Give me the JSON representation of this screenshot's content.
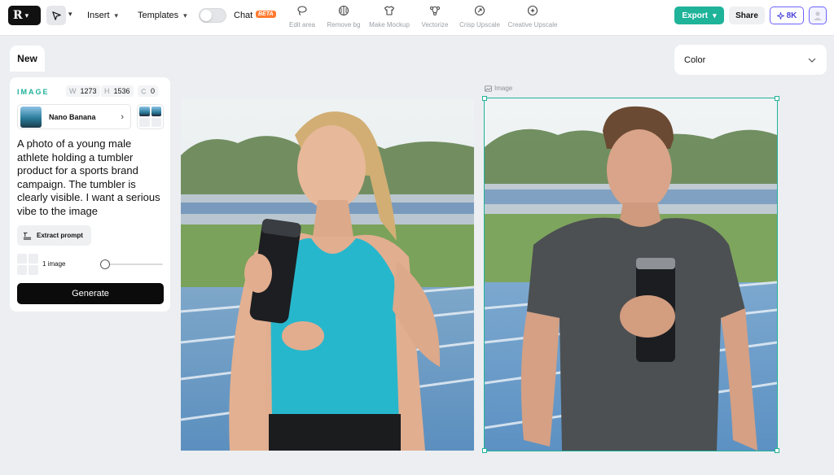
{
  "toolbar": {
    "menus": [
      {
        "label": "Insert"
      },
      {
        "label": "Templates"
      }
    ],
    "chat_label": "Chat",
    "beta_badge": "BETA",
    "tools": [
      {
        "label": "Edit area",
        "icon": "lasso-icon"
      },
      {
        "label": "Remove bg",
        "icon": "remove-bg-icon"
      },
      {
        "label": "Make Mockup",
        "icon": "shirt-icon"
      },
      {
        "label": "Vectorize",
        "icon": "vector-nodes-icon"
      },
      {
        "label": "Crisp Upscale",
        "icon": "upscale-icon"
      },
      {
        "label": "Creative Upscale",
        "icon": "sparkle-upscale-icon"
      }
    ],
    "export_label": "Export",
    "share_label": "Share",
    "credits_label": "8K"
  },
  "panel": {
    "new_tab": "New",
    "section_label": "IMAGE",
    "width_key": "W",
    "width_value": "1273",
    "height_key": "H",
    "height_value": "1536",
    "seed_value": "0",
    "model_name": "Nano Banana",
    "prompt": "A photo of a young male athlete holding a tumbler product for a sports brand campaign. The tumbler is clearly visible. I want a serious vibe to the image",
    "extract_label": "Extract prompt",
    "count_label": "1 image",
    "generate_label": "Generate"
  },
  "canvas": {
    "image_tag": "Image"
  },
  "color_dropdown": {
    "label": "Color"
  },
  "colors": {
    "accent": "#1fb39a",
    "credits": "#6c63ff",
    "beta": "#ff7a2f"
  }
}
